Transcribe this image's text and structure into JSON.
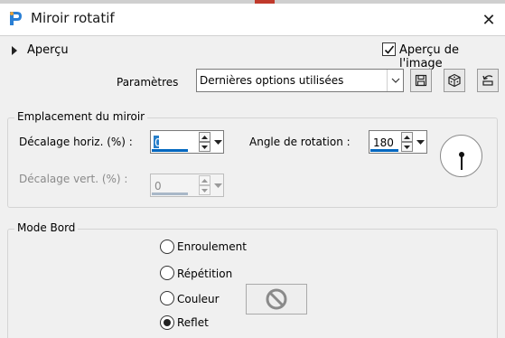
{
  "window": {
    "title": "Miroir rotatif",
    "close_label": "✕"
  },
  "preview": {
    "label": "Aperçu",
    "image_preview_label": "Aperçu de l'image",
    "image_preview_checked": true
  },
  "presets": {
    "label": "Paramètres",
    "selected": "Dernières options utilisées"
  },
  "mirror_location": {
    "title": "Emplacement du miroir",
    "horiz_label": "Décalage horiz. (%) :",
    "horiz_value": "0",
    "vert_label": "Décalage vert. (%) :",
    "vert_value": "0",
    "rotation_label": "Angle de rotation :",
    "rotation_value": "180"
  },
  "edge_mode": {
    "title": "Mode Bord",
    "options": [
      {
        "label": "Enroulement",
        "selected": false
      },
      {
        "label": "Répétition",
        "selected": false
      },
      {
        "label": "Couleur",
        "selected": false
      },
      {
        "label": "Reflet",
        "selected": true
      }
    ]
  },
  "colors": {
    "accent": "#0067c0",
    "background": "#f0f0f0"
  }
}
